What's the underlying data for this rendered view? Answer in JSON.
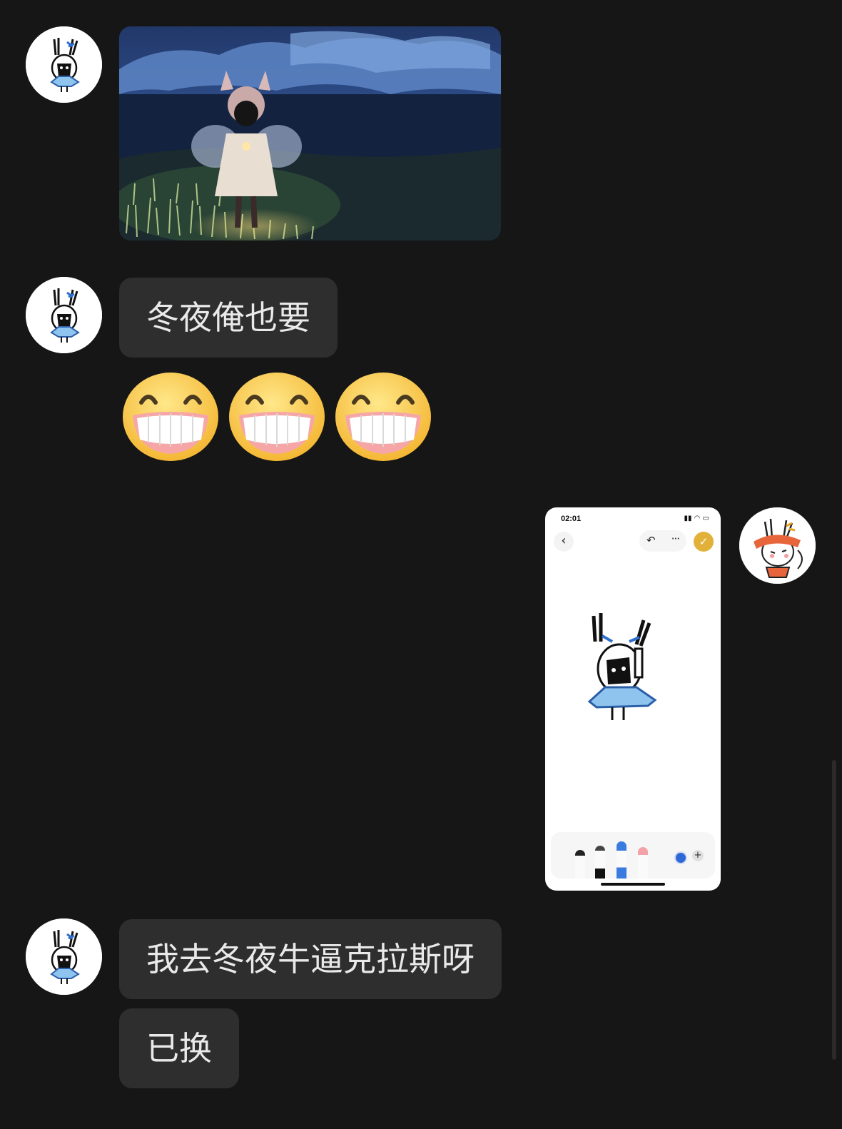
{
  "messages": [
    {
      "side": "left",
      "type": "image",
      "content": "game screenshot"
    },
    {
      "side": "left",
      "type": "text",
      "text": "冬夜俺也要"
    },
    {
      "side": "left",
      "type": "emoji",
      "emoji": "grin-icon",
      "count": 3
    },
    {
      "side": "right",
      "type": "image",
      "content": "phone drawing screenshot"
    },
    {
      "side": "left",
      "type": "text",
      "text": "我去冬夜牛逼克拉斯呀"
    },
    {
      "side": "left",
      "type": "text",
      "text": "已换"
    }
  ],
  "phone_screenshot": {
    "time": "02:01",
    "back_icon": "‹",
    "undo_icon": "↶",
    "more_icon": "···",
    "done_icon": "✓",
    "plus_icon": "+",
    "accent": "#e2b13a",
    "brush_color": "#2e6ad6"
  },
  "colors": {
    "background": "#161616",
    "bubble": "#2e2e2e",
    "text": "#e9e9e9"
  }
}
